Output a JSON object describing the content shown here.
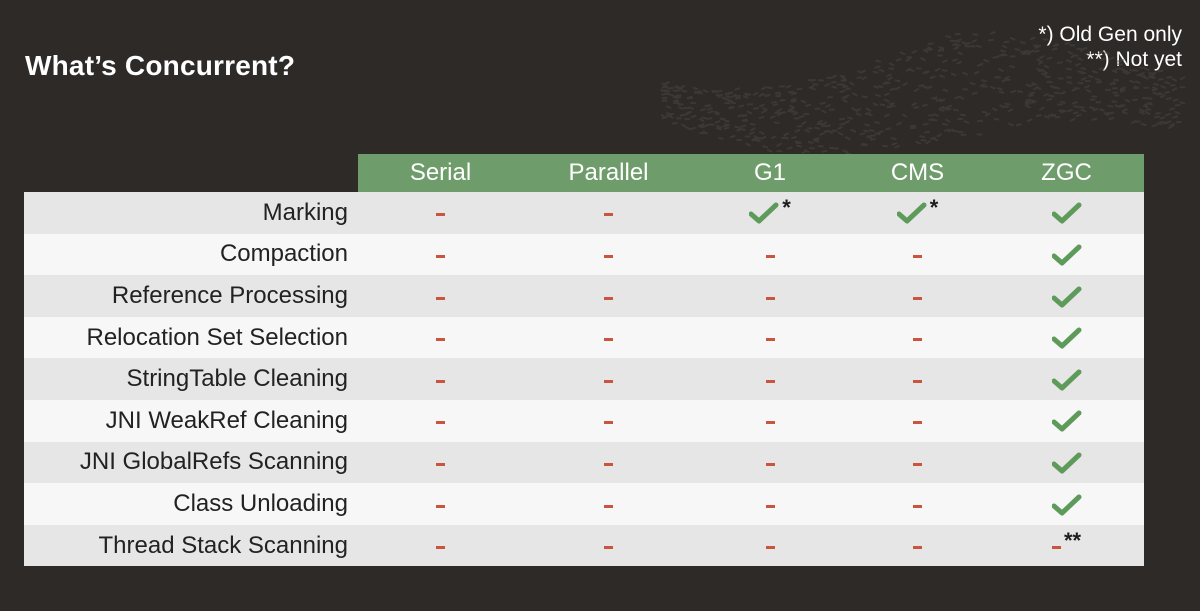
{
  "title": "What’s Concurrent?",
  "notes": [
    "*) Old Gen only",
    "**) Not yet"
  ],
  "columns": [
    "Serial",
    "Parallel",
    "G1",
    "CMS",
    "ZGC"
  ],
  "rows": [
    {
      "label": "Marking",
      "cells": [
        {
          "value": "no"
        },
        {
          "value": "no"
        },
        {
          "value": "yes",
          "mark": "*"
        },
        {
          "value": "yes",
          "mark": "*"
        },
        {
          "value": "yes"
        }
      ]
    },
    {
      "label": "Compaction",
      "cells": [
        {
          "value": "no"
        },
        {
          "value": "no"
        },
        {
          "value": "no"
        },
        {
          "value": "no"
        },
        {
          "value": "yes"
        }
      ]
    },
    {
      "label": "Reference Processing",
      "cells": [
        {
          "value": "no"
        },
        {
          "value": "no"
        },
        {
          "value": "no"
        },
        {
          "value": "no"
        },
        {
          "value": "yes"
        }
      ]
    },
    {
      "label": "Relocation Set Selection",
      "cells": [
        {
          "value": "no"
        },
        {
          "value": "no"
        },
        {
          "value": "no"
        },
        {
          "value": "no"
        },
        {
          "value": "yes"
        }
      ]
    },
    {
      "label": "StringTable Cleaning",
      "cells": [
        {
          "value": "no"
        },
        {
          "value": "no"
        },
        {
          "value": "no"
        },
        {
          "value": "no"
        },
        {
          "value": "yes"
        }
      ]
    },
    {
      "label": "JNI WeakRef Cleaning",
      "cells": [
        {
          "value": "no"
        },
        {
          "value": "no"
        },
        {
          "value": "no"
        },
        {
          "value": "no"
        },
        {
          "value": "yes"
        }
      ]
    },
    {
      "label": "JNI GlobalRefs Scanning",
      "cells": [
        {
          "value": "no"
        },
        {
          "value": "no"
        },
        {
          "value": "no"
        },
        {
          "value": "no"
        },
        {
          "value": "yes"
        }
      ]
    },
    {
      "label": "Class Unloading",
      "cells": [
        {
          "value": "no"
        },
        {
          "value": "no"
        },
        {
          "value": "no"
        },
        {
          "value": "no"
        },
        {
          "value": "yes"
        }
      ]
    },
    {
      "label": "Thread Stack Scanning",
      "cells": [
        {
          "value": "no"
        },
        {
          "value": "no"
        },
        {
          "value": "no"
        },
        {
          "value": "no"
        },
        {
          "value": "no",
          "mark": "**"
        }
      ]
    }
  ],
  "colors": {
    "background": "#2d2a28",
    "header": "#6f9c6b",
    "check": "#5e9a5a",
    "dash": "#c8553d",
    "row_odd": "#e6e6e6",
    "row_even": "#f7f7f7"
  }
}
